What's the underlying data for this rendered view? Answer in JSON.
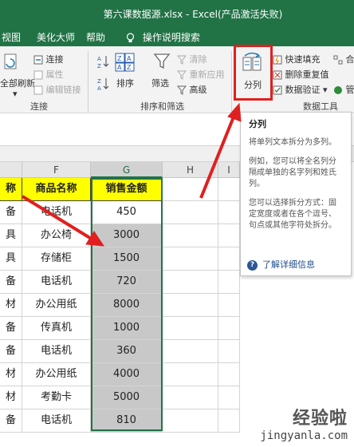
{
  "window": {
    "title": "第六课数据源.xlsx - Excel(产品激活失败)"
  },
  "menu": {
    "view": "视图",
    "beautify": "美化大师",
    "help": "帮助",
    "tell_me": "操作说明搜索"
  },
  "ribbon": {
    "connect": {
      "refresh_all": "全部刷新",
      "connections": "连接",
      "properties": "属性",
      "edit_links": "编辑链接",
      "group": "连接"
    },
    "sort_filter": {
      "sort": "排序",
      "filter": "筛选",
      "clear": "清除",
      "reapply": "重新应用",
      "advanced": "高级",
      "group": "排序和筛选"
    },
    "data_tools": {
      "split": "分列",
      "flash_fill": "快速填充",
      "remove_dup": "删除重复值",
      "validation": "数据验证",
      "group": "数据工具",
      "merge_partial": "合",
      "manage_partial": "管"
    }
  },
  "tooltip": {
    "title": "分列",
    "p1": "将单列文本拆分为多列。",
    "p2": "例如，您可以将全名列分隔成单独的名字列和姓氏列。",
    "p3": "您可以选择拆分方式：固定宽度或者在各个逗号、句点或其他字符处拆分。",
    "more": "了解详细信息"
  },
  "sheet": {
    "columns": [
      "F",
      "G",
      "H",
      "I"
    ],
    "headers": {
      "e": "称",
      "f": "商品名称",
      "g": "销售金额"
    },
    "rows": [
      {
        "e": "备",
        "f": "电话机",
        "g": "450"
      },
      {
        "e": "具",
        "f": "办公椅",
        "g": "3000"
      },
      {
        "e": "具",
        "f": "存储柜",
        "g": "1500"
      },
      {
        "e": "备",
        "f": "电话机",
        "g": "720"
      },
      {
        "e": "材",
        "f": "办公用纸",
        "g": "8000"
      },
      {
        "e": "备",
        "f": "传真机",
        "g": "1000"
      },
      {
        "e": "备",
        "f": "电话机",
        "g": "360"
      },
      {
        "e": "材",
        "f": "办公用纸",
        "g": "4000"
      },
      {
        "e": "材",
        "f": "考勤卡",
        "g": "5000"
      },
      {
        "e": "备",
        "f": "电话机",
        "g": "810"
      }
    ]
  },
  "colors": {
    "excel_green": "#217346",
    "header_yellow": "#ffff00",
    "selected_gray": "#c8c8c8",
    "annotation_red": "#e02020"
  },
  "watermark": {
    "cn": "经验啦",
    "en": "jingyanla.com"
  }
}
